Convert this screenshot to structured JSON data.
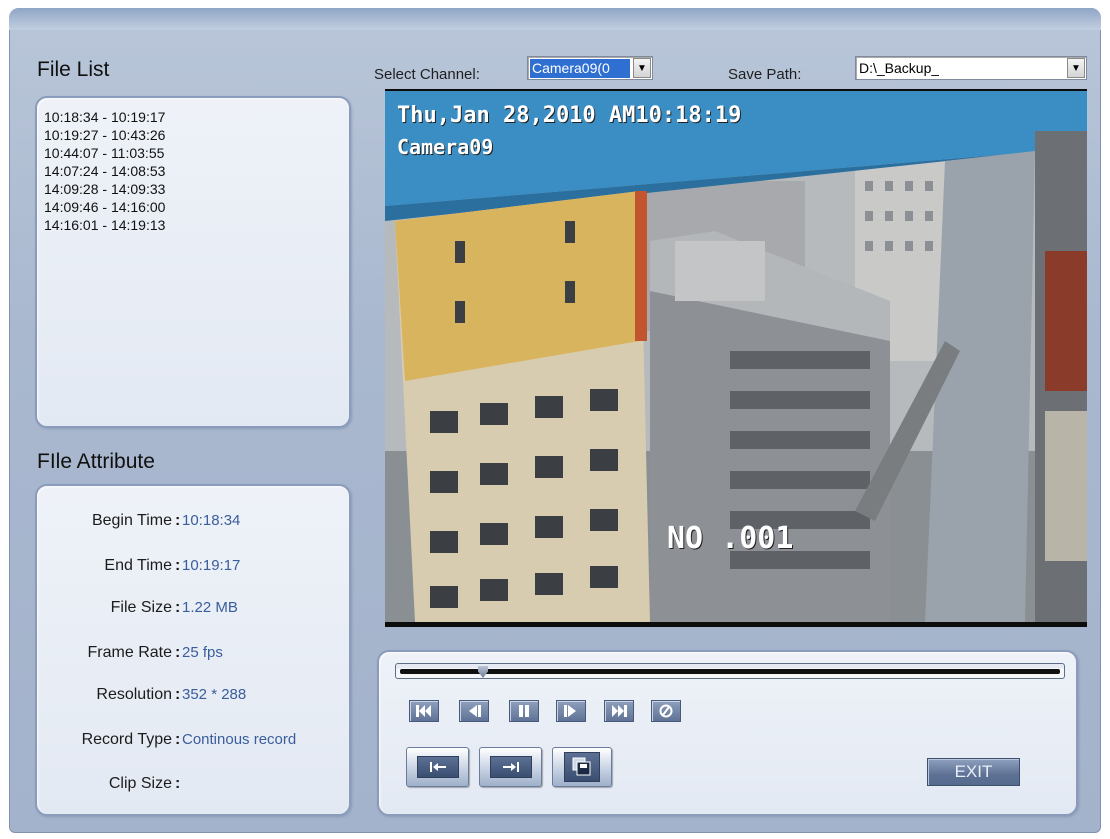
{
  "file_list": {
    "title": "File List",
    "items": [
      "10:18:34 - 10:19:17",
      "10:19:27 - 10:43:26",
      "10:44:07 - 11:03:55",
      "14:07:24 - 14:08:53",
      "14:09:28 - 14:09:33",
      "14:09:46 - 14:16:00",
      "14:16:01 - 14:19:13"
    ]
  },
  "file_attribute": {
    "title": "FIle Attribute",
    "rows": [
      {
        "label": "Begin Time",
        "value": "10:18:34"
      },
      {
        "label": "End Time",
        "value": "10:19:17"
      },
      {
        "label": "File Size",
        "value": "1.22 MB"
      },
      {
        "label": "Frame Rate",
        "value": "25 fps"
      },
      {
        "label": "Resolution",
        "value": "352 * 288"
      },
      {
        "label": "Record Type",
        "value": "Continous record"
      },
      {
        "label": "Clip Size",
        "value": ""
      }
    ]
  },
  "toolbar": {
    "channel_label": "Select Channel:",
    "channel_value": "Camera09(0",
    "save_path_label": "Save Path:",
    "save_path_value": "D:\\_Backup_"
  },
  "video": {
    "osd_datetime": "Thu,Jan 28,2010 AM10:18:19",
    "osd_camera": "Camera09",
    "osd_number": "NO .001"
  },
  "playback": {
    "progress_fraction": 0.12,
    "buttons": [
      "skip-to-start",
      "step-backward",
      "pause",
      "step-forward",
      "skip-to-end",
      "sound"
    ],
    "clip_buttons": [
      "mark-start",
      "mark-end",
      "save-clip"
    ]
  },
  "exit_label": "EXIT",
  "icons": {
    "dropdown_arrow": "chevron-down-icon"
  }
}
